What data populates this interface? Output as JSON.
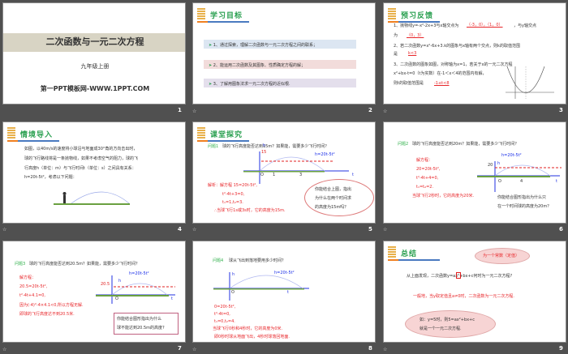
{
  "slides": [
    {
      "number": "1",
      "title": "二次函数与一元二次方程",
      "subtitle": "九年级上册",
      "footer": "第一PPT模板网-WWW.1PPT.COM"
    },
    {
      "number": "2",
      "heading": "学习目标",
      "goals": [
        "1、通过探索，理解二次函数与一元二次方程之间的联系；",
        "2、能运用二次函数及其图象、性质确定方程的解；",
        "3、了解用图象法求一元二次方程的近似根."
      ]
    },
    {
      "number": "3",
      "heading": "预习反馈",
      "lines": [
        "1、抛物线y=-x²-2x+3与x轴交点为",
        "，与y轴交点",
        "为",
        "2、若二次函数y=x²-6x+3.k的图象与x轴有两个交点，则k的取值范围",
        "是",
        "3、二次函数的图象如图，对称轴为x=1，若关于x的一元二次方程",
        "x²+bx-t=0（t为实数）在-1＜x＜4的范围内有解，",
        "则t的取值范围是"
      ],
      "answers": [
        "（-3，0），（1，0）",
        "（0，3）",
        "k<3",
        "-1≤t<8"
      ]
    },
    {
      "number": "4",
      "heading": "情境导入",
      "lines": [
        "如图，以40m/s的速度将小球沿与地面成30°角的方向击出时，",
        "球的飞行路线将是一条抛物线，如果不考虑空气的阻力，球的飞",
        "行高度h（单位：m）与飞行时间t（单位：s）之间具有关系：",
        "h=20t-5t²，考虑以下问题："
      ]
    },
    {
      "number": "5",
      "heading": "课堂探究",
      "question_label": "问题1",
      "question": "球的飞行高度能否达到15m？如果能，需要多少飞行时间？",
      "formula": "h=20t-5t²",
      "axis": {
        "h": "h",
        "t": "t",
        "o": "O",
        "v": "15",
        "x1": "1",
        "x2": "3"
      },
      "solution": [
        "解析：解方程 15=20t-5t²,",
        "t²-4t+3=0,",
        "t₁=1,t₂=3.",
        "∴当球飞行1s或3s时，它的高度为15m."
      ],
      "bubble": [
        "你能结合上图，指出",
        "为什么在两个时间求",
        "的高度为15m吗？"
      ]
    },
    {
      "number": "6",
      "question_label": "问题2",
      "question": "球的飞行高度能否达到20m？如果能，需要多少飞行时间？",
      "formula": "h=20t-5t²",
      "axis": {
        "h": "h",
        "t": "t",
        "o": "O",
        "v": "20",
        "x1": "4"
      },
      "solution": [
        "解方程：",
        "20=20t-5t²,",
        "t²-4t+4=0,",
        "t₁=t₂=2.",
        "当球飞行2秒时，它的高度为20米."
      ],
      "note": [
        "你能结合图形指出为什么只",
        "在一个时间球的高度为20m？"
      ]
    },
    {
      "number": "7",
      "question_label": "问题3",
      "question": "球的飞行高度能否达到20.5m？如果能，需要多少飞行时间？",
      "formula": "h=20t-5t²",
      "axis": {
        "h": "h",
        "t": "t",
        "o": "O",
        "v": "20.5"
      },
      "solution": [
        "解方程：",
        "20.5=20t-5t²,",
        "t²-4t+4.1=0,",
        "因为(-4)²-4×4.1<0,所以方程无解.",
        "即球的飞行高度达不到20.5米."
      ],
      "note": [
        "你能结合图形指出为什么",
        "球不能达到20.5m的高度?"
      ]
    },
    {
      "number": "8",
      "question_label": "问题4",
      "question": "球从飞出到落地要用多少时间？",
      "formula": "h=20t-5t²",
      "axis": {
        "h": "h",
        "t": "t",
        "o": "O"
      },
      "solution": [
        "0=20t-5t²,",
        "t²-4t=0,",
        "t₁=0,t₂=4.",
        "当球飞行0秒和4秒时，它的高度为0米.",
        "即0秒时球从地面飞出，4秒时球落回地面."
      ]
    },
    {
      "number": "9",
      "heading": "总结",
      "cloud_top": "为一个常数（定值）",
      "main": "从上面发现，二次函数y=ax²+bx+c何时为一元二次方程?",
      "red": "一般地，当y取定值且a≠0时，二次函数为一元二次方程.",
      "cloud_bottom": [
        "如：y=5时，则5=ax²+bx+c",
        "就是一个一元二次方程."
      ]
    }
  ],
  "animation_icon": "animation-star-icon",
  "colors": {
    "background": "#505050",
    "accent_red": "#e8262a",
    "accent_blue": "#1a2ee8",
    "heading_green": "#2aa050"
  }
}
